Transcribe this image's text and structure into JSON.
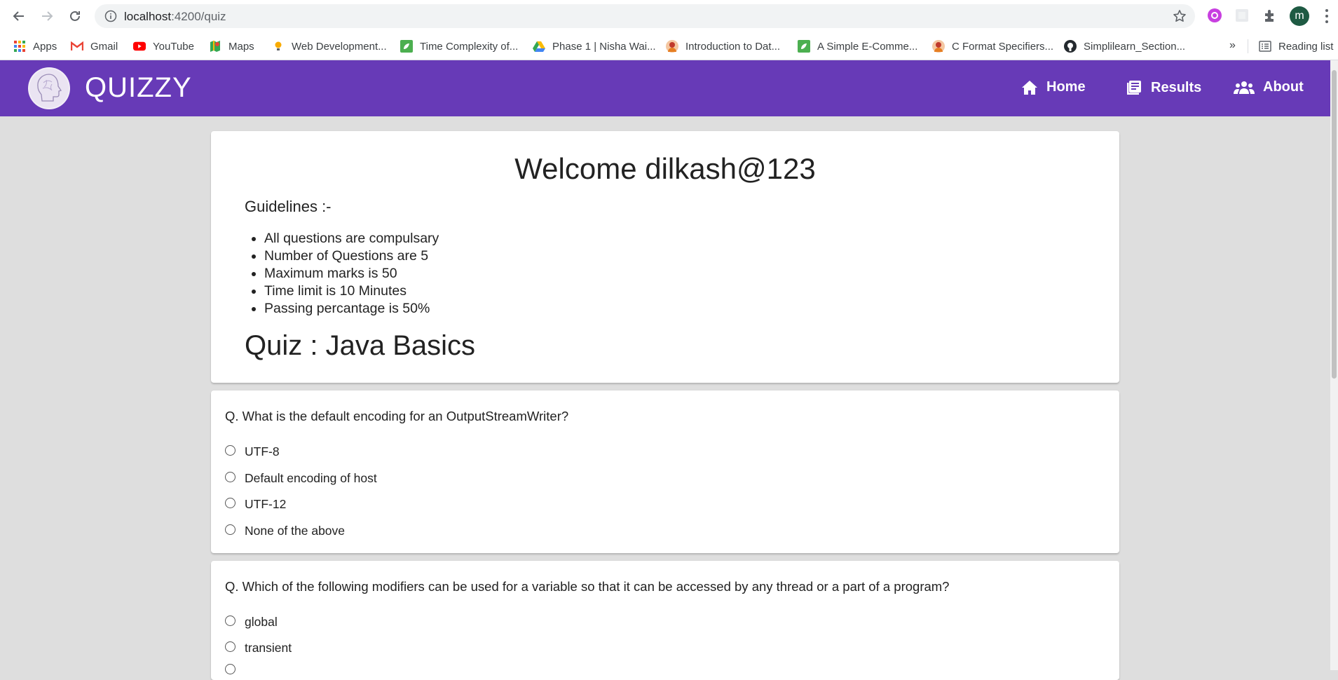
{
  "browser": {
    "url_host": "localhost",
    "url_path": ":4200/quiz",
    "profile_initial": "m",
    "bookmarks": [
      {
        "label": "Apps",
        "icon": "apps-grid-icon"
      },
      {
        "label": "Gmail",
        "icon": "gmail-icon"
      },
      {
        "label": "YouTube",
        "icon": "youtube-icon"
      },
      {
        "label": "Maps",
        "icon": "maps-icon"
      },
      {
        "label": "Web Development...",
        "icon": "bulb-icon"
      },
      {
        "label": "Time Complexity of...",
        "icon": "leaf-icon"
      },
      {
        "label": "Phase 1 | Nisha Wai...",
        "icon": "drive-icon"
      },
      {
        "label": "Introduction to Dat...",
        "icon": "avatar-icon"
      },
      {
        "label": "A Simple E-Comme...",
        "icon": "leaf-icon"
      },
      {
        "label": "C Format Specifiers...",
        "icon": "avatar-icon"
      },
      {
        "label": "Simplilearn_Section...",
        "icon": "github-icon"
      }
    ],
    "more_label": "»",
    "reading_list": "Reading list"
  },
  "app": {
    "brand": "QUIZZY",
    "nav": [
      {
        "label": "Home",
        "icon": "home-icon"
      },
      {
        "label": "Results",
        "icon": "results-icon"
      },
      {
        "label": "About",
        "icon": "people-icon"
      }
    ]
  },
  "intro": {
    "welcome": "Welcome dilkash@123",
    "guidelines_title": "Guidelines :-",
    "guidelines": [
      "All questions are compulsary",
      "Number of Questions are 5",
      "Maximum marks is 50",
      "Time limit is 10 Minutes",
      "Passing percantage is 50%"
    ],
    "quiz_title": "Quiz : Java Basics"
  },
  "questions": [
    {
      "text": "Q. What is the default encoding for an OutputStreamWriter?",
      "options": [
        "UTF-8",
        "Default encoding of host",
        "UTF-12",
        "None of the above"
      ]
    },
    {
      "text": "Q. Which of the following modifiers can be used for a variable so that it can be accessed by any thread or a part of a program?",
      "options": [
        "global",
        "transient"
      ]
    }
  ],
  "colors": {
    "primary": "#673ab7",
    "background": "#dedede",
    "card": "#ffffff"
  }
}
